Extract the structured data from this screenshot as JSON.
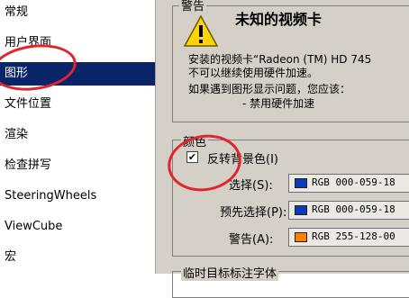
{
  "sidebar": {
    "items": [
      {
        "label": "常规"
      },
      {
        "label": "用户界面"
      },
      {
        "label": "图形",
        "selected": true
      },
      {
        "label": "文件位置"
      },
      {
        "label": "渲染"
      },
      {
        "label": "检查拼写"
      },
      {
        "label": "SteeringWheels"
      },
      {
        "label": "ViewCube"
      },
      {
        "label": "宏"
      }
    ]
  },
  "warning_group": {
    "title": "警告",
    "icon": "warning-triangle-icon",
    "heading": "未知的视频卡",
    "line1": "安装的视频卡“Radeon (TM) HD 745",
    "line2": "不可以继续使用硬件加速。",
    "line3": "如果遇到图形显示问题，您应该：",
    "line4": "- 禁用硬件加速"
  },
  "color_group": {
    "title": "颜色",
    "invert_bg": {
      "label": "反转背景色(I)",
      "checked": true
    },
    "rows": [
      {
        "label": "选择(S):",
        "swatch_color": "#0b3bb8",
        "value": "RGB 000-059-18"
      },
      {
        "label": "预先选择(P):",
        "swatch_color": "#0b3bb8",
        "value": "RGB 000-059-18"
      },
      {
        "label": "警告(A):",
        "swatch_color": "#ff8000",
        "value": "RGB 255-128-00"
      }
    ]
  },
  "bottom_group": {
    "title": "临时目标标注字体"
  },
  "annotation_color": "#e0262c"
}
